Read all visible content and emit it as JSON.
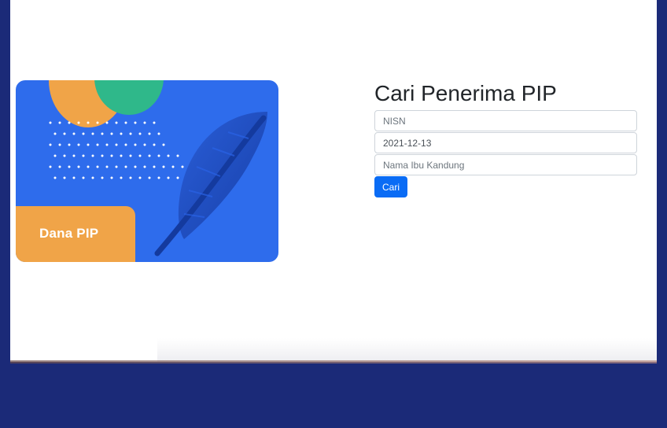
{
  "card": {
    "label": "Dana PIP",
    "colors": {
      "background": "#2e6cec",
      "orange": "#f0a448",
      "green": "#2fb88a",
      "feather": "#1f4fc4"
    },
    "icon": "feather-icon"
  },
  "form": {
    "title": "Cari Penerima PIP",
    "nisn_placeholder": "NISN",
    "date_value": "2021-12-13",
    "mother_name_placeholder": "Nama Ibu Kandung",
    "submit_label": "Cari"
  },
  "colors": {
    "outer_frame": "#1b2a78",
    "button": "#0a6cf5"
  }
}
